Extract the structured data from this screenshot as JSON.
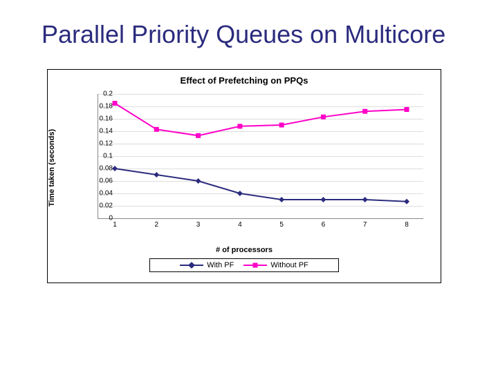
{
  "slide": {
    "title": "Parallel Priority Queues on Multicore"
  },
  "chart_data": {
    "type": "line",
    "title": "Effect of Prefetching on PPQs",
    "xlabel": "# of processors",
    "ylabel": "Time taken (seconds)",
    "ylim": [
      0,
      0.2
    ],
    "yticks": [
      0,
      0.02,
      0.04,
      0.06,
      0.08,
      0.1,
      0.12,
      0.14,
      0.16,
      0.18,
      0.2
    ],
    "categories": [
      1,
      2,
      3,
      4,
      5,
      6,
      7,
      8
    ],
    "series": [
      {
        "name": "With PF",
        "color": "#2b2b7e",
        "marker": "diamond",
        "values": [
          0.08,
          0.07,
          0.06,
          0.04,
          0.03,
          0.03,
          0.03,
          0.027
        ]
      },
      {
        "name": "Without PF",
        "color": "#ff00c8",
        "marker": "square",
        "values": [
          0.185,
          0.143,
          0.133,
          0.148,
          0.15,
          0.163,
          0.172,
          0.175
        ]
      }
    ],
    "legend_position": "bottom"
  }
}
